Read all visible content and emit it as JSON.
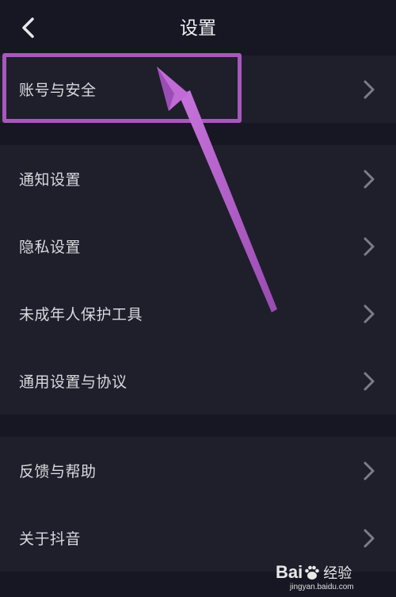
{
  "header": {
    "title": "设置",
    "back_icon": "chevron-left-icon"
  },
  "groups": [
    {
      "items": [
        {
          "label": "账号与安全"
        }
      ]
    },
    {
      "items": [
        {
          "label": "通知设置"
        },
        {
          "label": "隐私设置"
        },
        {
          "label": "未成年人保护工具"
        },
        {
          "label": "通用设置与协议"
        }
      ]
    },
    {
      "items": [
        {
          "label": "反馈与帮助"
        },
        {
          "label": "关于抖音"
        }
      ]
    }
  ],
  "annotation": {
    "color": "#a758bd",
    "highlighted_item": "账号与安全"
  },
  "watermark": {
    "logo_text_a": "Bai",
    "logo_text_b": "经验",
    "url": "jingyan.baidu.com"
  },
  "colors": {
    "background": "#161722",
    "row_background": "#1e1f2b",
    "text": "#d9d9de",
    "chevron": "#7c7d88"
  }
}
